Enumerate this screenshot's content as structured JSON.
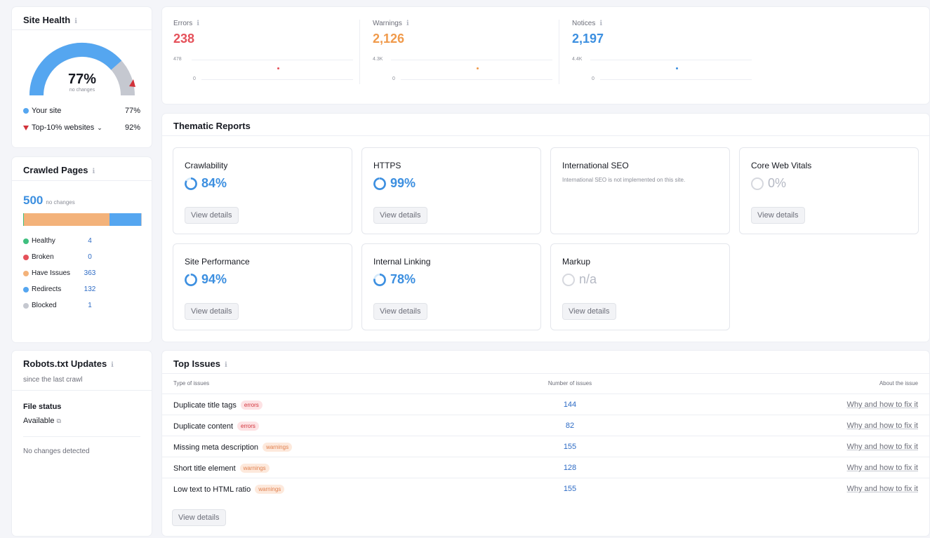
{
  "site_health": {
    "title": "Site Health",
    "percent": "77%",
    "percent_value": 77,
    "change": "no changes",
    "legend": [
      {
        "label": "Your site",
        "value": "77%"
      },
      {
        "label": "Top-10% websites",
        "value": "92%"
      }
    ],
    "colors": {
      "site": "#55a6f0",
      "top": "#d1323a",
      "rest": "#c5c8d0"
    }
  },
  "crawled_pages": {
    "title": "Crawled Pages",
    "count": "500",
    "change": "no changes",
    "bar": [
      {
        "name": "Healthy",
        "value": 4,
        "color": "#3fbf7f"
      },
      {
        "name": "Broken",
        "value": 0,
        "color": "#e5515a"
      },
      {
        "name": "Have issues",
        "value": 363,
        "color": "#f3b27a"
      },
      {
        "name": "Redirects",
        "value": 132,
        "color": "#55a6f0"
      },
      {
        "name": "Blocked",
        "value": 1,
        "color": "#c5c8d0"
      }
    ],
    "items": [
      {
        "label": "Healthy",
        "value": "4"
      },
      {
        "label": "Broken",
        "value": "0"
      },
      {
        "label": "Have Issues",
        "value": "363"
      },
      {
        "label": "Redirects",
        "value": "132"
      },
      {
        "label": "Blocked",
        "value": "1"
      }
    ]
  },
  "robots": {
    "title": "Robots.txt Updates",
    "subtitle": "since the last crawl",
    "file_status_label": "File status",
    "file_status_value": "Available",
    "no_changes": "No changes detected"
  },
  "metrics": [
    {
      "label": "Errors",
      "value": "238",
      "max": "478",
      "min": "0",
      "color": "#e5515a"
    },
    {
      "label": "Warnings",
      "value": "2,126",
      "max": "4.3K",
      "min": "0",
      "color": "#f09a4b"
    },
    {
      "label": "Notices",
      "value": "2,197",
      "max": "4.4K",
      "min": "0",
      "color": "#3c8fe0"
    }
  ],
  "thematic": {
    "title": "Thematic Reports",
    "button": "View details",
    "reports": [
      {
        "name": "Crawlability",
        "value": "84%"
      },
      {
        "name": "HTTPS",
        "value": "99%"
      },
      {
        "name": "International SEO",
        "desc": "International SEO is not implemented on this site."
      },
      {
        "name": "Core Web Vitals",
        "value": "0%"
      },
      {
        "name": "Site Performance",
        "value": "94%"
      },
      {
        "name": "Internal Linking",
        "value": "78%"
      },
      {
        "name": "Markup",
        "value": "n/a"
      }
    ]
  },
  "top_issues": {
    "title": "Top Issues",
    "col_type": "Type of issues",
    "col_count": "Number of issues",
    "col_about": "About the issue",
    "fix_label": "Why and how to fix it",
    "button": "View details",
    "rows": [
      {
        "name": "Duplicate title tags",
        "tag": "errors",
        "count": "144"
      },
      {
        "name": "Duplicate content",
        "tag": "errors",
        "count": "82"
      },
      {
        "name": "Missing meta description",
        "tag": "warnings",
        "count": "155"
      },
      {
        "name": "Short title element",
        "tag": "warnings",
        "count": "128"
      },
      {
        "name": "Low text to HTML ratio",
        "tag": "warnings",
        "count": "155"
      }
    ]
  }
}
